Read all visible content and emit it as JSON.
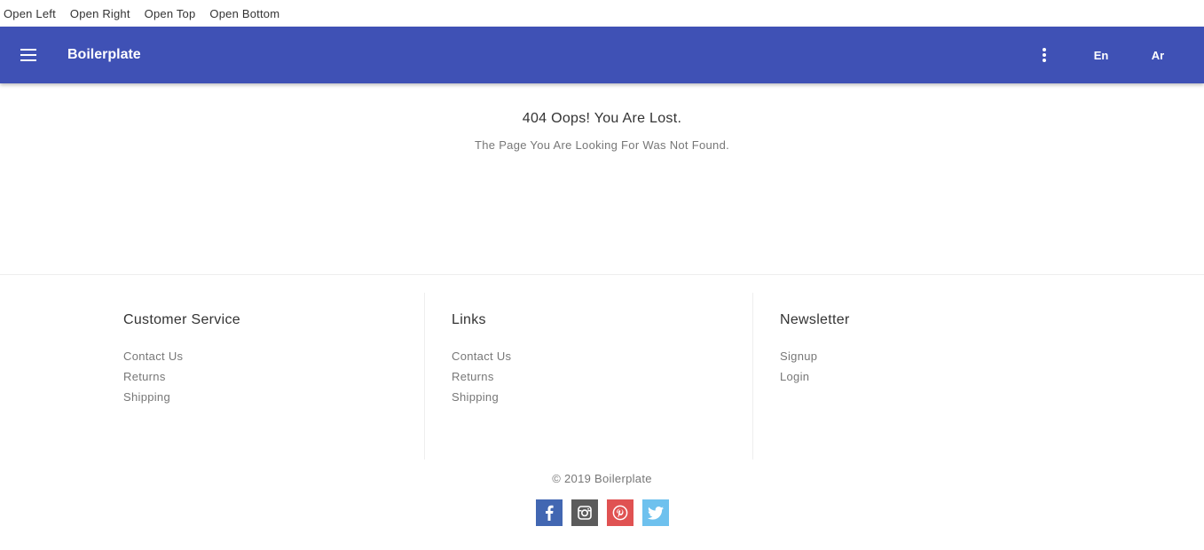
{
  "drawer_controls": [
    "Open Left",
    "Open Right",
    "Open Top",
    "Open Bottom"
  ],
  "header": {
    "brand": "Boilerplate",
    "menu_icon": "hamburger-menu-icon",
    "more_icon": "more-vertical-icon",
    "languages": [
      "En",
      "Ar"
    ],
    "background_color": "#3f51b5"
  },
  "error": {
    "title": "404 Oops! You Are Lost.",
    "message": "The Page You Are Looking For Was Not Found."
  },
  "footer": {
    "columns": [
      {
        "title": "Customer Service",
        "links": [
          "Contact Us",
          "Returns",
          "Shipping"
        ]
      },
      {
        "title": "Links",
        "links": [
          "Contact Us",
          "Returns",
          "Shipping"
        ]
      },
      {
        "title": "Newsletter",
        "links": [
          "Signup",
          "Login"
        ]
      }
    ],
    "copyright": "© 2019 Boilerplate",
    "social": [
      {
        "icon": "facebook-icon",
        "color": "#4267b2"
      },
      {
        "icon": "instagram-icon",
        "color": "#5b5b5b"
      },
      {
        "icon": "pinterest-icon",
        "color": "#e05252"
      },
      {
        "icon": "twitter-icon",
        "color": "#6ec1ee"
      }
    ]
  }
}
